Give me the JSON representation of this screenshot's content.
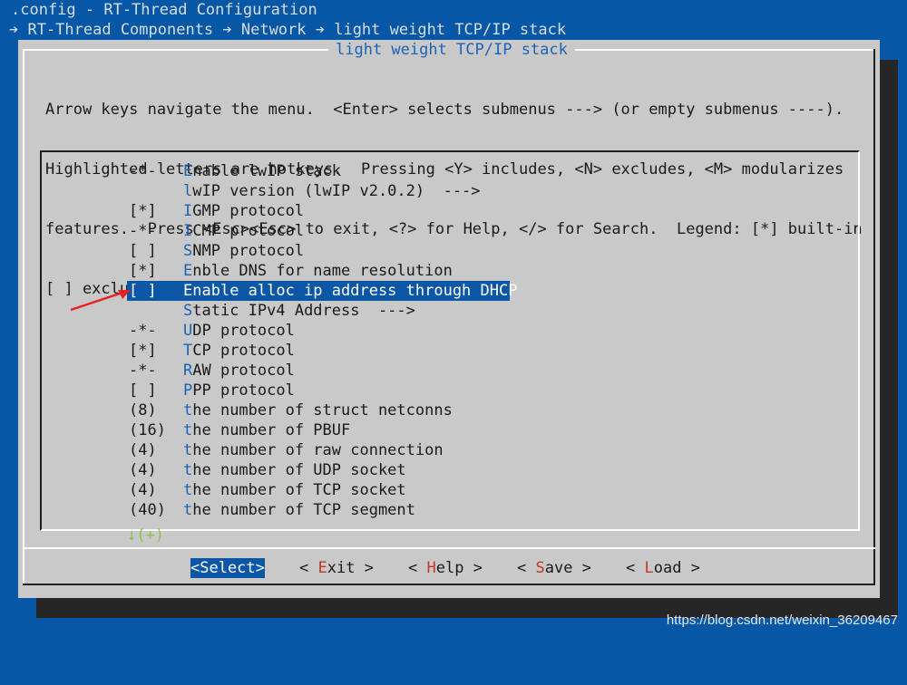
{
  "window": {
    "title": ".config - RT-Thread Configuration",
    "breadcrumb": "➔ RT-Thread Components ➔ Network ➔ light weight TCP/IP stack"
  },
  "dialog": {
    "title": "light weight TCP/IP stack",
    "help_lines": [
      "Arrow keys navigate the menu.  <Enter> selects submenus ---> (or empty submenus ----).",
      "Highlighted letters are hotkeys.  Pressing <Y> includes, <N> excludes, <M> modularizes",
      "features.  Press <Esc><Esc> to exit, <?> for Help, </> for Search.  Legend: [*] built-in",
      "[ ] excluded  <M> module  < > module capable"
    ]
  },
  "menu": {
    "items": [
      {
        "prefix": "-*-",
        "hot": "E",
        "rest": "nable lwIP stack",
        "selected": false
      },
      {
        "prefix": "",
        "hot": "l",
        "rest": "wIP version (lwIP v2.0.2)  --->",
        "selected": false
      },
      {
        "prefix": "[*]",
        "hot": "I",
        "rest": "GMP protocol",
        "selected": false
      },
      {
        "prefix": "-*-",
        "hot": "I",
        "rest": "CMP protocol",
        "selected": false
      },
      {
        "prefix": "[ ]",
        "hot": "S",
        "rest": "NMP protocol",
        "selected": false
      },
      {
        "prefix": "[*]",
        "hot": "E",
        "rest": "nble DNS for name resolution",
        "selected": false
      },
      {
        "prefix": "[ ]",
        "hot": "E",
        "rest": "nable alloc ip address through DHCP",
        "selected": true
      },
      {
        "prefix": "",
        "hot": "S",
        "rest": "tatic IPv4 Address  --->",
        "selected": false
      },
      {
        "prefix": "-*-",
        "hot": "U",
        "rest": "DP protocol",
        "selected": false
      },
      {
        "prefix": "[*]",
        "hot": "T",
        "rest": "CP protocol",
        "selected": false
      },
      {
        "prefix": "-*-",
        "hot": "R",
        "rest": "AW protocol",
        "selected": false
      },
      {
        "prefix": "[ ]",
        "hot": "P",
        "rest": "PP protocol",
        "selected": false
      },
      {
        "prefix": "(8)",
        "hot": "t",
        "rest": "he number of struct netconns",
        "selected": false
      },
      {
        "prefix": "(16)",
        "hot": "t",
        "rest": "he number of PBUF",
        "selected": false
      },
      {
        "prefix": "(4)",
        "hot": "t",
        "rest": "he number of raw connection",
        "selected": false
      },
      {
        "prefix": "(4)",
        "hot": "t",
        "rest": "he number of UDP socket",
        "selected": false
      },
      {
        "prefix": "(4)",
        "hot": "t",
        "rest": "he number of TCP socket",
        "selected": false
      },
      {
        "prefix": "(40)",
        "hot": "t",
        "rest": "he number of TCP segment",
        "selected": false
      }
    ],
    "more_indicator": "↓(+)"
  },
  "buttons": {
    "select": {
      "label": "<Select>"
    },
    "exit": {
      "pre": "< ",
      "hot": "E",
      "rest": "xit >"
    },
    "help": {
      "pre": "< ",
      "hot": "H",
      "rest": "elp >"
    },
    "save": {
      "pre": "< ",
      "hot": "S",
      "rest": "ave >"
    },
    "load": {
      "pre": "< ",
      "hot": "L",
      "rest": "oad >"
    }
  },
  "watermark": "https://blog.csdn.net/weixin_36209467",
  "colors": {
    "background": "#0757a7",
    "dialog": "#c9c9c9",
    "highlight": "#0b57a6",
    "hotkey": "#1b63b8",
    "button_hotkey": "#c0392b",
    "more_indicator": "#8bc34a",
    "annotation_arrow": "#e52222"
  }
}
